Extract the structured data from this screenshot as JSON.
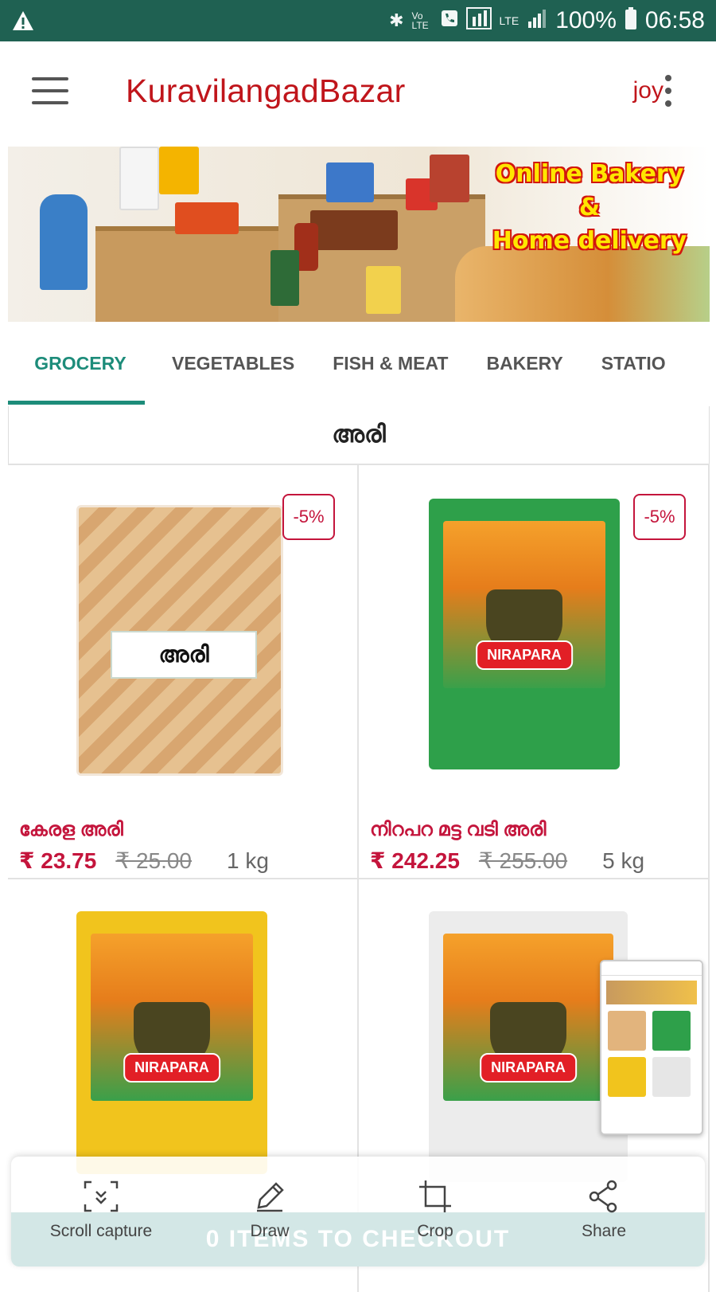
{
  "status_bar": {
    "battery": "100%",
    "time": "06:58",
    "icons": [
      "warning-icon",
      "bluetooth-icon",
      "volte-icon",
      "call-icon",
      "screenshot-icon",
      "lte-icon",
      "signal-icon",
      "battery-icon"
    ],
    "volte_label": "Vo LTE",
    "lte_label": "LTE"
  },
  "app_bar": {
    "title": "KuravilangadBazar",
    "user": "joy"
  },
  "banner": {
    "line1": "Online Bakery",
    "line2": "&",
    "line3": "Home delivery"
  },
  "tabs": [
    {
      "label": "GROCERY",
      "active": true
    },
    {
      "label": "VEGETABLES",
      "active": false
    },
    {
      "label": "FISH & MEAT",
      "active": false
    },
    {
      "label": "BAKERY",
      "active": false
    },
    {
      "label": "STATIO",
      "active": false
    }
  ],
  "section": {
    "title": "അരി"
  },
  "products": [
    {
      "name": "കേരള അരി",
      "price": "₹ 23.75",
      "mrp": "₹ 25.00",
      "unit": "1 kg",
      "discount": "-5%",
      "image_label": "അരി"
    },
    {
      "name": "നിറപറ മട്ട വടി അരി",
      "price": "₹ 242.25",
      "mrp": "₹ 255.00",
      "unit": "5 kg",
      "discount": "-5%",
      "image_label": "NIRAPARA"
    },
    {
      "image_label": "NIRAPARA"
    },
    {
      "image_label": "NIRAPARA"
    }
  ],
  "checkout": {
    "label": "0 ITEMS TO CHECKOUT"
  },
  "screenshot_toolbar": {
    "scroll_capture": "Scroll capture",
    "draw": "Draw",
    "crop": "Crop",
    "share": "Share"
  },
  "colors": {
    "status_bar": "#1f6152",
    "accent": "#1d8c7a",
    "title_red": "#c0151b",
    "price_red": "#c4153c"
  }
}
